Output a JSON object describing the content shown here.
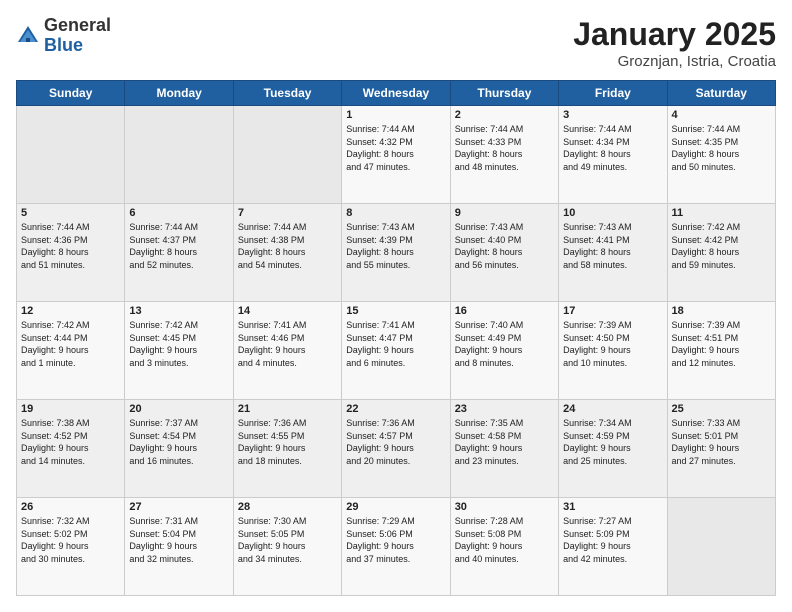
{
  "logo": {
    "general": "General",
    "blue": "Blue"
  },
  "title": "January 2025",
  "location": "Groznjan, Istria, Croatia",
  "headers": [
    "Sunday",
    "Monday",
    "Tuesday",
    "Wednesday",
    "Thursday",
    "Friday",
    "Saturday"
  ],
  "weeks": [
    [
      {
        "day": "",
        "info": ""
      },
      {
        "day": "",
        "info": ""
      },
      {
        "day": "",
        "info": ""
      },
      {
        "day": "1",
        "info": "Sunrise: 7:44 AM\nSunset: 4:32 PM\nDaylight: 8 hours\nand 47 minutes."
      },
      {
        "day": "2",
        "info": "Sunrise: 7:44 AM\nSunset: 4:33 PM\nDaylight: 8 hours\nand 48 minutes."
      },
      {
        "day": "3",
        "info": "Sunrise: 7:44 AM\nSunset: 4:34 PM\nDaylight: 8 hours\nand 49 minutes."
      },
      {
        "day": "4",
        "info": "Sunrise: 7:44 AM\nSunset: 4:35 PM\nDaylight: 8 hours\nand 50 minutes."
      }
    ],
    [
      {
        "day": "5",
        "info": "Sunrise: 7:44 AM\nSunset: 4:36 PM\nDaylight: 8 hours\nand 51 minutes."
      },
      {
        "day": "6",
        "info": "Sunrise: 7:44 AM\nSunset: 4:37 PM\nDaylight: 8 hours\nand 52 minutes."
      },
      {
        "day": "7",
        "info": "Sunrise: 7:44 AM\nSunset: 4:38 PM\nDaylight: 8 hours\nand 54 minutes."
      },
      {
        "day": "8",
        "info": "Sunrise: 7:43 AM\nSunset: 4:39 PM\nDaylight: 8 hours\nand 55 minutes."
      },
      {
        "day": "9",
        "info": "Sunrise: 7:43 AM\nSunset: 4:40 PM\nDaylight: 8 hours\nand 56 minutes."
      },
      {
        "day": "10",
        "info": "Sunrise: 7:43 AM\nSunset: 4:41 PM\nDaylight: 8 hours\nand 58 minutes."
      },
      {
        "day": "11",
        "info": "Sunrise: 7:42 AM\nSunset: 4:42 PM\nDaylight: 8 hours\nand 59 minutes."
      }
    ],
    [
      {
        "day": "12",
        "info": "Sunrise: 7:42 AM\nSunset: 4:44 PM\nDaylight: 9 hours\nand 1 minute."
      },
      {
        "day": "13",
        "info": "Sunrise: 7:42 AM\nSunset: 4:45 PM\nDaylight: 9 hours\nand 3 minutes."
      },
      {
        "day": "14",
        "info": "Sunrise: 7:41 AM\nSunset: 4:46 PM\nDaylight: 9 hours\nand 4 minutes."
      },
      {
        "day": "15",
        "info": "Sunrise: 7:41 AM\nSunset: 4:47 PM\nDaylight: 9 hours\nand 6 minutes."
      },
      {
        "day": "16",
        "info": "Sunrise: 7:40 AM\nSunset: 4:49 PM\nDaylight: 9 hours\nand 8 minutes."
      },
      {
        "day": "17",
        "info": "Sunrise: 7:39 AM\nSunset: 4:50 PM\nDaylight: 9 hours\nand 10 minutes."
      },
      {
        "day": "18",
        "info": "Sunrise: 7:39 AM\nSunset: 4:51 PM\nDaylight: 9 hours\nand 12 minutes."
      }
    ],
    [
      {
        "day": "19",
        "info": "Sunrise: 7:38 AM\nSunset: 4:52 PM\nDaylight: 9 hours\nand 14 minutes."
      },
      {
        "day": "20",
        "info": "Sunrise: 7:37 AM\nSunset: 4:54 PM\nDaylight: 9 hours\nand 16 minutes."
      },
      {
        "day": "21",
        "info": "Sunrise: 7:36 AM\nSunset: 4:55 PM\nDaylight: 9 hours\nand 18 minutes."
      },
      {
        "day": "22",
        "info": "Sunrise: 7:36 AM\nSunset: 4:57 PM\nDaylight: 9 hours\nand 20 minutes."
      },
      {
        "day": "23",
        "info": "Sunrise: 7:35 AM\nSunset: 4:58 PM\nDaylight: 9 hours\nand 23 minutes."
      },
      {
        "day": "24",
        "info": "Sunrise: 7:34 AM\nSunset: 4:59 PM\nDaylight: 9 hours\nand 25 minutes."
      },
      {
        "day": "25",
        "info": "Sunrise: 7:33 AM\nSunset: 5:01 PM\nDaylight: 9 hours\nand 27 minutes."
      }
    ],
    [
      {
        "day": "26",
        "info": "Sunrise: 7:32 AM\nSunset: 5:02 PM\nDaylight: 9 hours\nand 30 minutes."
      },
      {
        "day": "27",
        "info": "Sunrise: 7:31 AM\nSunset: 5:04 PM\nDaylight: 9 hours\nand 32 minutes."
      },
      {
        "day": "28",
        "info": "Sunrise: 7:30 AM\nSunset: 5:05 PM\nDaylight: 9 hours\nand 34 minutes."
      },
      {
        "day": "29",
        "info": "Sunrise: 7:29 AM\nSunset: 5:06 PM\nDaylight: 9 hours\nand 37 minutes."
      },
      {
        "day": "30",
        "info": "Sunrise: 7:28 AM\nSunset: 5:08 PM\nDaylight: 9 hours\nand 40 minutes."
      },
      {
        "day": "31",
        "info": "Sunrise: 7:27 AM\nSunset: 5:09 PM\nDaylight: 9 hours\nand 42 minutes."
      },
      {
        "day": "",
        "info": ""
      }
    ]
  ]
}
